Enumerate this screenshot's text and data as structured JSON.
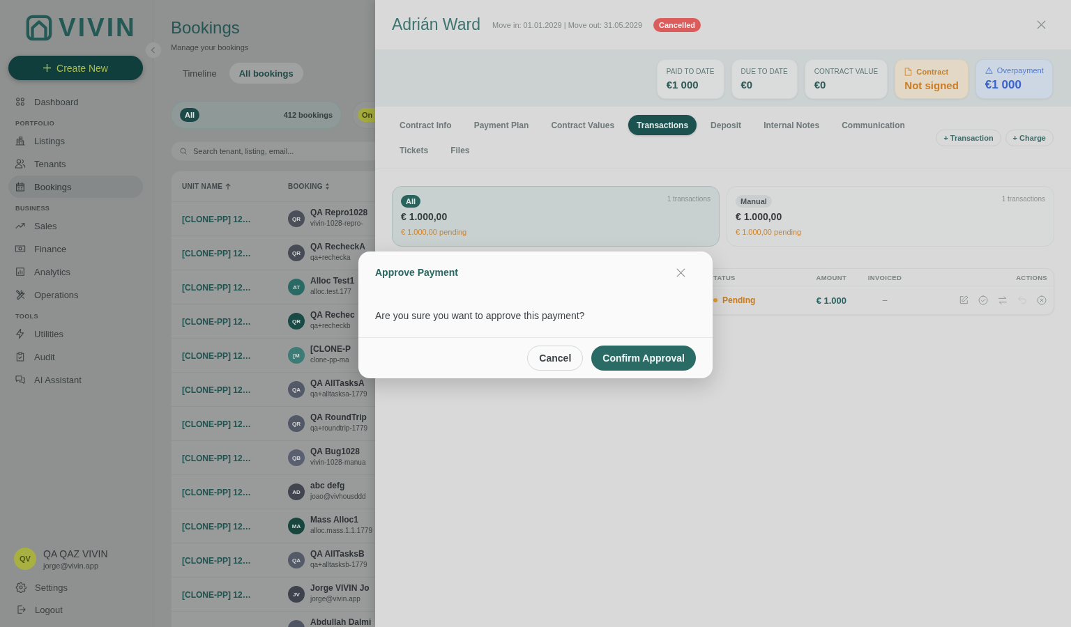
{
  "sidebar": {
    "logo": "VIVIN",
    "create_button": {
      "label": "Create New"
    },
    "nav": [
      {
        "items": [
          {
            "label": "Dashboard",
            "selected": false
          }
        ]
      },
      {
        "title": "PORTFOLIO",
        "items": [
          {
            "label": "Listings",
            "selected": false
          },
          {
            "label": "Tenants",
            "selected": false
          },
          {
            "label": "Bookings",
            "selected": true
          }
        ]
      },
      {
        "title": "BUSINESS",
        "items": [
          {
            "label": "Sales",
            "selected": false
          },
          {
            "label": "Finance",
            "selected": false
          },
          {
            "label": "Analytics",
            "selected": false
          },
          {
            "label": "Operations",
            "selected": false
          }
        ]
      },
      {
        "title": "TOOLS",
        "items": [
          {
            "label": "Utilities",
            "selected": false
          },
          {
            "label": "Audit",
            "selected": false
          },
          {
            "label": "AI Assistant",
            "selected": false
          }
        ]
      }
    ],
    "user": {
      "initials": "QV",
      "name": "QA QAZ VIVIN",
      "email": "jorge@vivin.app"
    },
    "footer": [
      {
        "label": "Settings"
      },
      {
        "label": "Logout"
      }
    ]
  },
  "bookings_page": {
    "title": "Bookings",
    "subtitle": "Manage your bookings",
    "tabs": [
      {
        "label": "Timeline",
        "selected": false
      },
      {
        "label": "All bookings",
        "selected": true
      }
    ],
    "filters": [
      {
        "label": "All",
        "count": "412 bookings",
        "color": "#1d4a47",
        "selected": true
      },
      {
        "label": "On",
        "color": "#a4ab3c",
        "selected": false
      }
    ],
    "search": {
      "placeholder": "Search tenant, listing, email..."
    },
    "table": {
      "columns": [
        {
          "label": "UNIT NAME"
        },
        {
          "label": "BOOKING"
        }
      ],
      "rows": [
        {
          "unit": "[CLONE-PP] 12…",
          "initials": "QR",
          "name": "QA Repro1028",
          "email": "vivin-1028-repro-",
          "color": "#4a4f5a"
        },
        {
          "unit": "[CLONE-PP] 12…",
          "initials": "QR",
          "name": "QA RecheckA",
          "email": "qa+rechecka",
          "color": "#464b56"
        },
        {
          "unit": "[CLONE-PP] 12…",
          "initials": "AT",
          "name": "Alloc Test1",
          "email": "alloc.test.177",
          "color": "#2a6a65"
        },
        {
          "unit": "[CLONE-PP] 12…",
          "initials": "QR",
          "name": "QA Rechec",
          "email": "qa+recheckb",
          "color": "#184a46"
        },
        {
          "unit": "[CLONE-PP] 12…",
          "initials": "[M",
          "name": "[CLONE-P",
          "email": "clone-pp-ma",
          "color": "#3b7c76"
        },
        {
          "unit": "[CLONE-PP] 12…",
          "initials": "QA",
          "name": "QA AllTasksA",
          "email": "qa+alltasksa-1779",
          "color": "#545968"
        },
        {
          "unit": "[CLONE-PP] 12…",
          "initials": "QR",
          "name": "QA RoundTrip",
          "email": "qa+roundtrip-1779",
          "color": "#535867"
        },
        {
          "unit": "[CLONE-PP] 12…",
          "initials": "QB",
          "name": "QA Bug1028",
          "email": "vivin-1028-manua",
          "color": "#5a6070"
        },
        {
          "unit": "[CLONE-PP] 12…",
          "initials": "AD",
          "name": "abc defg",
          "email": "joao@vivhousddd",
          "color": "#41454f"
        },
        {
          "unit": "[CLONE-PP] 12…",
          "initials": "MA",
          "name": "Mass Alloc1",
          "email": "alloc.mass.1.1.1779",
          "color": "#18463f"
        },
        {
          "unit": "[CLONE-PP] 12…",
          "initials": "QA",
          "name": "QA AllTasksB",
          "email": "qa+alltasksb-1779",
          "color": "#555a69"
        },
        {
          "unit": "[CLONE-PP] 12…",
          "initials": "JV",
          "name": "Jorge VIVIN Jo",
          "email": "jorge@vivin.app",
          "color": "#3e424c"
        },
        {
          "name": "Abdullah Dalmi",
          "color": "#505564"
        }
      ]
    }
  },
  "booking_drawer": {
    "header": {
      "name": "Adrián Ward",
      "dates": "Move in: 01.01.2029 | Move out: 31.05.2029",
      "status": "Cancelled"
    },
    "metrics": [
      {
        "kind": "plain",
        "label": "PAID TO DATE",
        "value": "€1 000"
      },
      {
        "kind": "plain",
        "label": "DUE TO DATE",
        "value": "€0"
      },
      {
        "kind": "plain",
        "label": "CONTRACT VALUE",
        "value": "€0"
      },
      {
        "kind": "pending",
        "label": "Contract",
        "value": "Not signed"
      },
      {
        "kind": "alert",
        "label": "Overpayment",
        "value": "€1 000"
      }
    ],
    "tabs": [
      {
        "label": "Contract Info",
        "selected": false
      },
      {
        "label": "Payment Plan",
        "selected": false
      },
      {
        "label": "Contract Values",
        "selected": false
      },
      {
        "label": "Transactions",
        "selected": true
      },
      {
        "label": "Deposit",
        "selected": false
      },
      {
        "label": "Internal Notes",
        "selected": false
      },
      {
        "label": "Communication",
        "selected": false
      },
      {
        "label": "Tickets",
        "selected": false
      },
      {
        "label": "Files",
        "selected": false
      }
    ],
    "actions": [
      {
        "label": "+ Transaction"
      },
      {
        "label": "+ Charge"
      }
    ],
    "groups": [
      {
        "label": "All",
        "count": "1 transactions",
        "total": "€ 1.000,00",
        "pending": "€ 1.000,00 pending",
        "selected": true
      },
      {
        "label": "Manual",
        "count": "1 transactions",
        "total": "€ 1.000,00",
        "pending": "€ 1.000,00 pending",
        "selected": false
      }
    ],
    "transactions": {
      "columns": [
        {
          "label": "TATUS"
        },
        {
          "label": "AMOUNT"
        },
        {
          "label": "INVOICED"
        },
        {
          "label": "ACTIONS"
        }
      ],
      "rows": [
        {
          "status": "Pending",
          "amount": "€ 1.000",
          "invoiced": "–",
          "actions": [
            {
              "disabled": false
            },
            {
              "disabled": false
            },
            {
              "disabled": false
            },
            {
              "disabled": true
            },
            {
              "disabled": false
            }
          ]
        }
      ]
    }
  },
  "dialog": {
    "title": "Approve Payment",
    "message": "Are you sure you want to approve this payment?",
    "buttons": [
      {
        "label": "Cancel",
        "kind": "secondary"
      },
      {
        "label": "Confirm Approval",
        "kind": "primary"
      }
    ]
  }
}
